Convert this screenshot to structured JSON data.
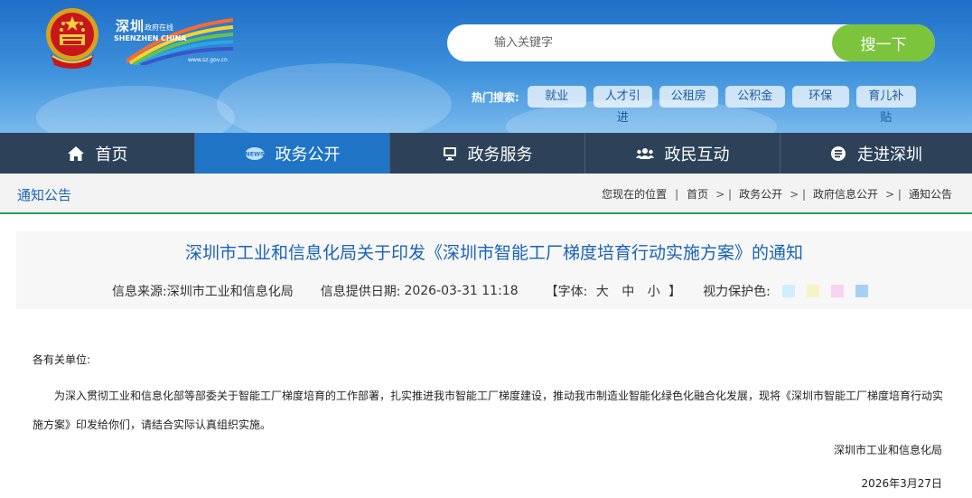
{
  "header": {
    "logo_title": "深圳",
    "logo_sub": "政府在线",
    "logo_en": "SHENZHEN CHINA",
    "logo_url": "www.sz.gov.cn",
    "search_placeholder": "输入关键字",
    "search_button": "搜一下",
    "hot_label": "热门搜索:",
    "hot_tags": [
      "就业",
      "人才引进",
      "公租房",
      "公积金",
      "环保",
      "育儿补贴"
    ]
  },
  "nav": {
    "items": [
      {
        "label": "首页",
        "icon": "home-icon"
      },
      {
        "label": "政务公开",
        "icon": "news-icon",
        "active": true
      },
      {
        "label": "政务服务",
        "icon": "monitor-icon"
      },
      {
        "label": "政民互动",
        "icon": "people-icon"
      },
      {
        "label": "走进深圳",
        "icon": "info-icon"
      }
    ]
  },
  "breadcrumb": {
    "section_title": "通知公告",
    "items": [
      "您现在的位置",
      "首页",
      "政务公开",
      "政府信息公开",
      "通知公告"
    ]
  },
  "article": {
    "title": "深圳市工业和信息化局关于印发《深圳市智能工厂梯度培育行动实施方案》的通知",
    "source_label": "信息来源:",
    "source": "深圳市工业和信息化局",
    "date_label": "信息提供日期:",
    "date": "2026-03-31 11:18",
    "font_label_open": "【字体:",
    "font_large": "大",
    "font_medium": "中",
    "font_small": "小",
    "font_label_close": "】",
    "eye_label": "视力保护色:",
    "eye_colors": [
      "#cfeefb",
      "#f8f3c6",
      "#f7d2f1",
      "#a8d0f5"
    ],
    "greeting": "各有关单位:",
    "paragraph": "为深入贯彻工业和信息化部等部委关于智能工厂梯度培育的工作部署，扎实推进我市智能工厂梯度建设，推动我市制造业智能化绿色化融合化发展，现将《深圳市智能工厂梯度培育行动实施方案》印发给你们，请结合实际认真组织实施。",
    "signature": "深圳市工业和信息化局",
    "sign_date": "2026年3月27日"
  },
  "colors": {
    "nav_bg": "#2d4259",
    "nav_active": "#1f74c6",
    "search_button": "#7cc43c",
    "title_blue": "#1a63b4",
    "divider_green": "#1fa261"
  }
}
